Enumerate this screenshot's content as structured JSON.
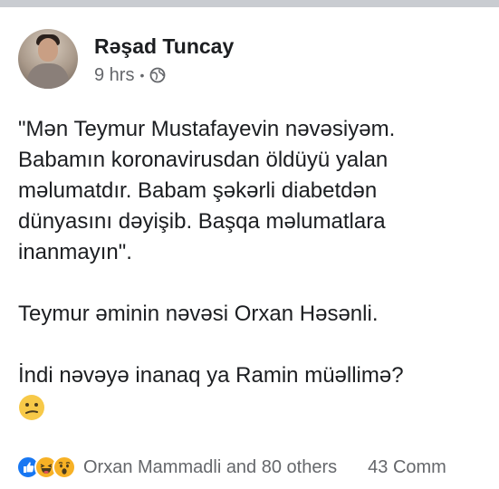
{
  "post": {
    "author": "Rəşad Tuncay",
    "time": "9 hrs",
    "separator": "•",
    "privacy_icon": "globe-icon",
    "text": {
      "quote_lines": [
        "\"Mən Teymur Mustafayevin nəvəsiyəm.",
        "Babamın koronavirusdan öldüyü yalan",
        "məlumatdır. Babam şəkərli diabetdən",
        "dünyasını dəyişib. Başqa məlumatlara",
        "inanmayın\"."
      ],
      "line2": "Teymur əminin nəvəsi Orxan Həsənli.",
      "line3": "İndi nəvəyə inanaq ya Ramin müəllimə?",
      "emoji_icon": "confused-face-icon"
    }
  },
  "footer": {
    "reactions": [
      "like-icon",
      "haha-icon",
      "wow-icon"
    ],
    "reactors_text": "Orxan Mammadli and 80 others",
    "comments_text": "43 Comm"
  },
  "colors": {
    "author_text": "#1c1e21",
    "secondary_text": "#65676b",
    "like_blue": "#1877f2",
    "reaction_yellow": "#f7b125"
  }
}
